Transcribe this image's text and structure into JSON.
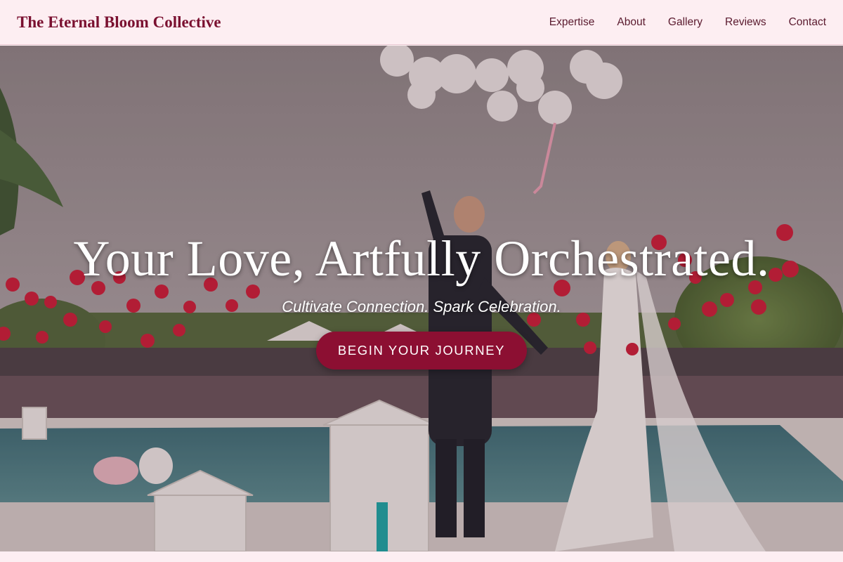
{
  "brand": {
    "name": "The Eternal Bloom Collective"
  },
  "nav": {
    "items": [
      {
        "label": "Expertise",
        "name": "nav-expertise"
      },
      {
        "label": "About",
        "name": "nav-about"
      },
      {
        "label": "Gallery",
        "name": "nav-gallery"
      },
      {
        "label": "Reviews",
        "name": "nav-reviews"
      },
      {
        "label": "Contact",
        "name": "nav-contact"
      }
    ]
  },
  "hero": {
    "headline": "Your Love, Artfully Orchestrated.",
    "tagline": "Cultivate Connection. Spark Celebration.",
    "cta_label": "BEGIN YOUR JOURNEY",
    "image_subject": "wedding-couple-releasing-balloons"
  },
  "colors": {
    "brand": "#7a1030",
    "header_bg": "#fdeef2",
    "cta_bg": "#8c0f32",
    "nav_text": "#5a1a2e"
  }
}
